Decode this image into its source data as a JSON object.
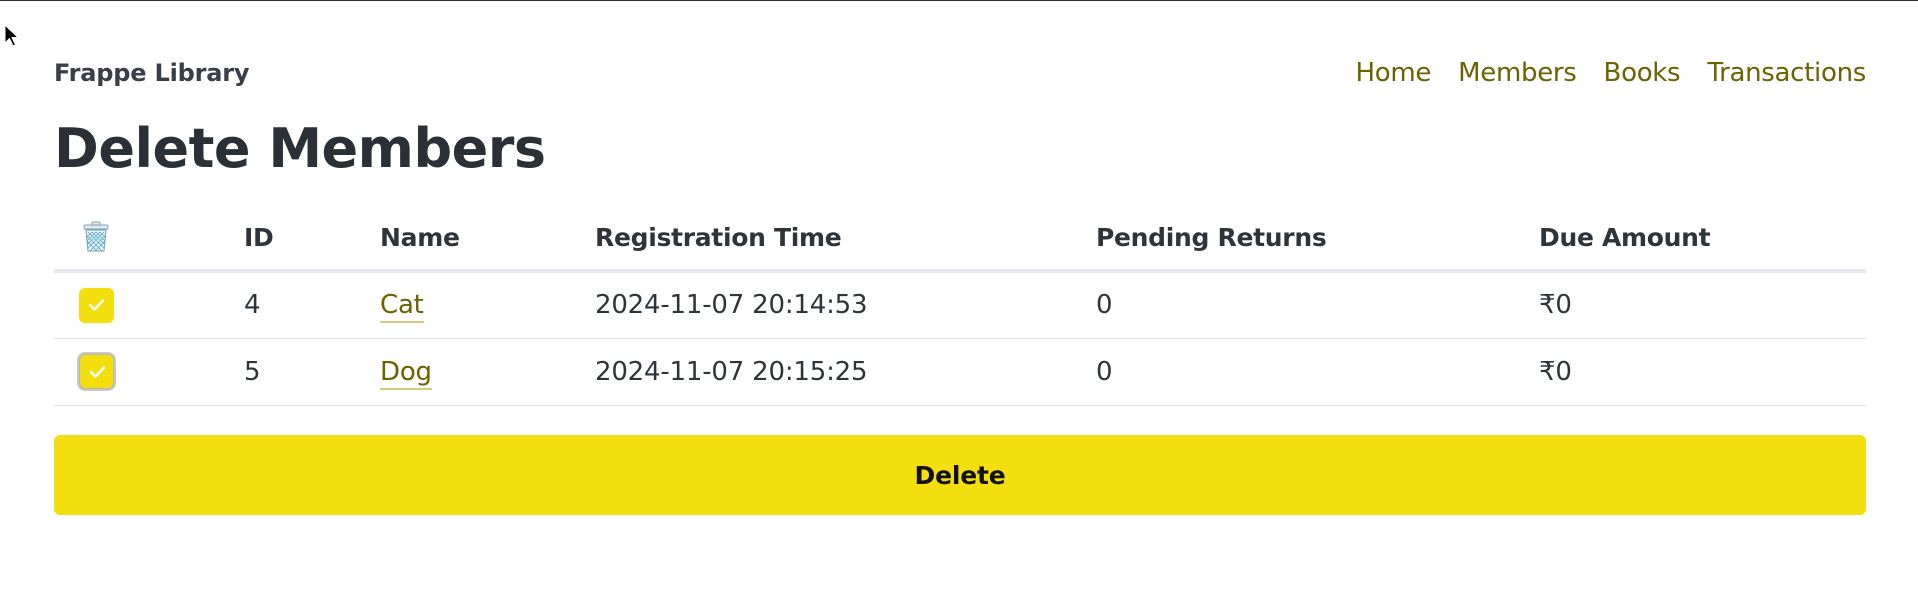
{
  "app": {
    "brand": "Frappe Library"
  },
  "nav": {
    "items": [
      {
        "label": "Home"
      },
      {
        "label": "Members"
      },
      {
        "label": "Books"
      },
      {
        "label": "Transactions"
      }
    ]
  },
  "page": {
    "title": "Delete Members"
  },
  "table": {
    "headers": {
      "select_icon": "trash-icon",
      "id": "ID",
      "name": "Name",
      "registration_time": "Registration Time",
      "pending_returns": "Pending Returns",
      "due_amount": "Due Amount"
    },
    "rows": [
      {
        "checked": true,
        "id": "4",
        "name": "Cat",
        "registration_time": "2024-11-07 20:14:53",
        "pending_returns": "0",
        "due_amount": "₹0"
      },
      {
        "checked": true,
        "id": "5",
        "name": "Dog",
        "registration_time": "2024-11-07 20:15:25",
        "pending_returns": "0",
        "due_amount": "₹0"
      }
    ]
  },
  "actions": {
    "delete_label": "Delete"
  },
  "colors": {
    "accent": "#f2df0d",
    "link": "#6b6200",
    "text": "#2b2f36"
  }
}
